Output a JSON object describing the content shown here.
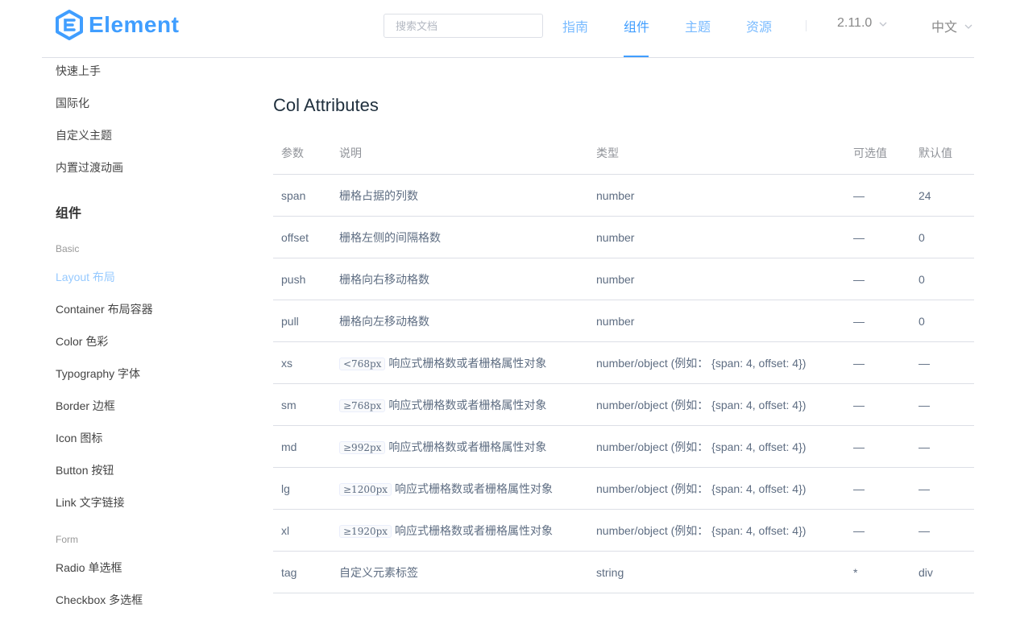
{
  "header": {
    "logo_text": "Element",
    "search_placeholder": "搜索文档",
    "nav": [
      "指南",
      "组件",
      "主题",
      "资源"
    ],
    "active_nav": "组件",
    "version": "2.11.0",
    "language": "中文",
    "brand_color": "#409eff"
  },
  "sidebar": {
    "top_items": [
      "快速上手",
      "国际化",
      "自定义主题",
      "内置过渡动画"
    ],
    "heading": "组件",
    "group_basic": "Basic",
    "basic_items": [
      "Layout 布局",
      "Container 布局容器",
      "Color 色彩",
      "Typography 字体",
      "Border 边框",
      "Icon 图标",
      "Button 按钮",
      "Link 文字链接"
    ],
    "active_item": "Layout 布局",
    "group_form": "Form",
    "form_items": [
      "Radio 单选框",
      "Checkbox 多选框"
    ]
  },
  "content": {
    "title": "Col Attributes",
    "columns": [
      "参数",
      "说明",
      "类型",
      "可选值",
      "默认值"
    ],
    "rows": [
      {
        "param": "span",
        "code": "",
        "desc": "栅格占据的列数",
        "type": "number",
        "options": "—",
        "default": "24"
      },
      {
        "param": "offset",
        "code": "",
        "desc": "栅格左侧的间隔格数",
        "type": "number",
        "options": "—",
        "default": "0"
      },
      {
        "param": "push",
        "code": "",
        "desc": "栅格向右移动格数",
        "type": "number",
        "options": "—",
        "default": "0"
      },
      {
        "param": "pull",
        "code": "",
        "desc": "栅格向左移动格数",
        "type": "number",
        "options": "—",
        "default": "0"
      },
      {
        "param": "xs",
        "code": "<768px",
        "desc": "响应式栅格数或者栅格属性对象",
        "type": "number/object (例如： {span: 4, offset: 4})",
        "options": "—",
        "default": "—"
      },
      {
        "param": "sm",
        "code": "≥768px",
        "desc": "响应式栅格数或者栅格属性对象",
        "type": "number/object (例如： {span: 4, offset: 4})",
        "options": "—",
        "default": "—"
      },
      {
        "param": "md",
        "code": "≥992px",
        "desc": "响应式栅格数或者栅格属性对象",
        "type": "number/object (例如： {span: 4, offset: 4})",
        "options": "—",
        "default": "—"
      },
      {
        "param": "lg",
        "code": "≥1200px",
        "desc": "响应式栅格数或者栅格属性对象",
        "type": "number/object (例如： {span: 4, offset: 4})",
        "options": "—",
        "default": "—"
      },
      {
        "param": "xl",
        "code": "≥1920px",
        "desc": "响应式栅格数或者栅格属性对象",
        "type": "number/object (例如： {span: 4, offset: 4})",
        "options": "—",
        "default": "—"
      },
      {
        "param": "tag",
        "code": "",
        "desc": "自定义元素标签",
        "type": "string",
        "options": "*",
        "default": "div"
      }
    ]
  }
}
